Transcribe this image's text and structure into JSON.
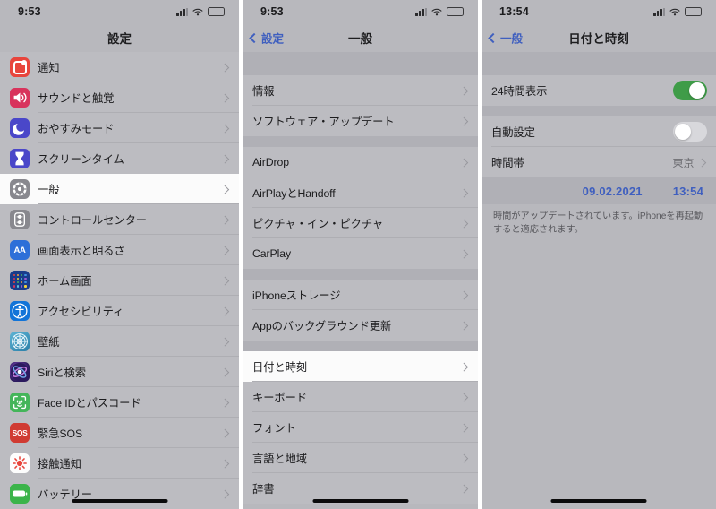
{
  "panels": [
    {
      "id": "settings",
      "status": {
        "time": "9:53",
        "signal_icon": "cellular-signal-icon",
        "wifi_icon": "wifi-icon",
        "battery_icon": "battery-icon"
      },
      "nav": {
        "title": "設定",
        "back_label": null
      },
      "groups": [
        {
          "spacer": "tall",
          "rows": [
            {
              "label": "通知",
              "icon": "notifications-icon",
              "icon_class": "ic-notif",
              "kind": "chevron"
            },
            {
              "label": "サウンドと触覚",
              "icon": "sounds-haptics-icon",
              "icon_class": "ic-sound",
              "kind": "chevron"
            },
            {
              "label": "おやすみモード",
              "icon": "do-not-disturb-icon",
              "icon_class": "ic-dnd",
              "kind": "chevron"
            },
            {
              "label": "スクリーンタイム",
              "icon": "screen-time-icon",
              "icon_class": "ic-screen",
              "kind": "chevron"
            }
          ]
        },
        {
          "spacer": "tall",
          "rows": [
            {
              "label": "一般",
              "icon": "general-gear-icon",
              "icon_class": "ic-gen",
              "kind": "chevron",
              "selected": true
            },
            {
              "label": "コントロールセンター",
              "icon": "control-center-icon",
              "icon_class": "ic-cc",
              "kind": "chevron"
            },
            {
              "label": "画面表示と明るさ",
              "icon": "display-brightness-icon",
              "icon_class": "ic-disp",
              "kind": "chevron"
            },
            {
              "label": "ホーム画面",
              "icon": "home-screen-icon",
              "icon_class": "ic-home",
              "kind": "chevron"
            },
            {
              "label": "アクセシビリティ",
              "icon": "accessibility-icon",
              "icon_class": "ic-acc",
              "kind": "chevron"
            },
            {
              "label": "壁紙",
              "icon": "wallpaper-icon",
              "icon_class": "ic-wall",
              "kind": "chevron"
            },
            {
              "label": "Siriと検索",
              "icon": "siri-search-icon",
              "icon_class": "ic-siri",
              "kind": "chevron"
            },
            {
              "label": "Face IDとパスコード",
              "icon": "face-id-icon",
              "icon_class": "ic-face",
              "kind": "chevron"
            },
            {
              "label": "緊急SOS",
              "icon": "emergency-sos-icon",
              "icon_class": "ic-sos",
              "kind": "chevron"
            },
            {
              "label": "接触通知",
              "icon": "exposure-notifications-icon",
              "icon_class": "ic-expo",
              "kind": "chevron"
            },
            {
              "label": "バッテリー",
              "icon": "battery-settings-icon",
              "icon_class": "ic-batt",
              "kind": "chevron"
            }
          ]
        }
      ]
    },
    {
      "id": "general",
      "status": {
        "time": "9:53"
      },
      "nav": {
        "title": "一般",
        "back_label": "設定"
      },
      "groups": [
        {
          "spacer": "tall",
          "rows": [
            {
              "label": "情報",
              "kind": "chevron"
            },
            {
              "label": "ソフトウェア・アップデート",
              "kind": "chevron"
            }
          ]
        },
        {
          "spacer": "short",
          "rows": [
            {
              "label": "AirDrop",
              "kind": "chevron"
            },
            {
              "label": "AirPlayとHandoff",
              "kind": "chevron"
            },
            {
              "label": "ピクチャ・イン・ピクチャ",
              "kind": "chevron"
            },
            {
              "label": "CarPlay",
              "kind": "chevron"
            }
          ]
        },
        {
          "spacer": "short",
          "rows": [
            {
              "label": "iPhoneストレージ",
              "kind": "chevron"
            },
            {
              "label": "Appのバックグラウンド更新",
              "kind": "chevron"
            }
          ]
        },
        {
          "spacer": "short",
          "rows": [
            {
              "label": "日付と時刻",
              "kind": "chevron",
              "selected": true
            },
            {
              "label": "キーボード",
              "kind": "chevron"
            },
            {
              "label": "フォント",
              "kind": "chevron"
            },
            {
              "label": "言語と地域",
              "kind": "chevron"
            },
            {
              "label": "辞書",
              "kind": "chevron"
            }
          ]
        }
      ]
    },
    {
      "id": "date-time",
      "status": {
        "time": "13:54"
      },
      "nav": {
        "title": "日付と時刻",
        "back_label": "一般"
      },
      "groups": [
        {
          "spacer": "tall",
          "rows": [
            {
              "label": "24時間表示",
              "kind": "toggle",
              "toggle_on": true
            }
          ]
        },
        {
          "spacer": "short",
          "rows": [
            {
              "label": "自動設定",
              "kind": "toggle",
              "toggle_on": false
            },
            {
              "label": "時間帯",
              "kind": "chevron",
              "value": "東京"
            }
          ]
        }
      ],
      "datetime": {
        "date": "09.02.2021",
        "time": "13:54"
      },
      "footnote": "時間がアップデートされています。iPhoneを再起動すると適応されます。"
    }
  ],
  "colors": {
    "accent_blue": "#3f5fbf",
    "toggle_on_green": "#3f9c48",
    "toggle_off_gray": "#d8d8dc",
    "list_bg": "#bcbcc1",
    "group_spacer": "#b0b0b6"
  }
}
